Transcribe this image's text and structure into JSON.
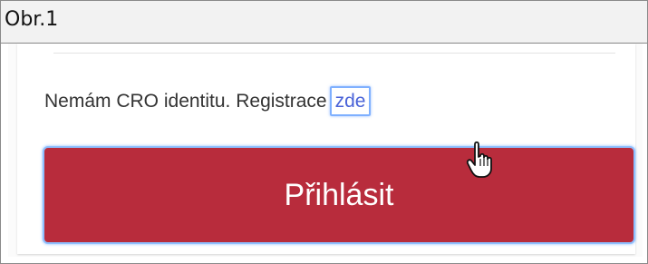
{
  "caption": {
    "text": "Obr.1"
  },
  "registration": {
    "prefix": "Nemám CRO identitu. Registrace",
    "link_text": "zde"
  },
  "login": {
    "label": "Přihlásit"
  },
  "colors": {
    "button_bg": "#b82c3c",
    "link": "#4a63d8",
    "focus_outline": "#7fb0ff"
  },
  "icons": {
    "cursor": "hand-pointer-icon"
  }
}
